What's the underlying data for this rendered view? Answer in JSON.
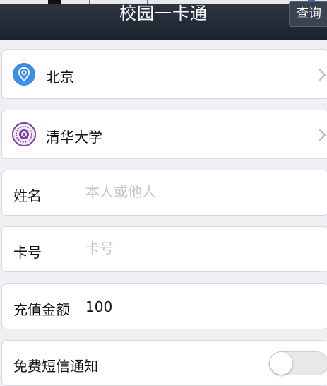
{
  "header": {
    "title": "校园一卡通",
    "query_label": "查询"
  },
  "location": {
    "city": "北京",
    "icon": "location-pin-icon",
    "icon_color": "#3d8ee6"
  },
  "school": {
    "name": "清华大学",
    "icon": "university-seal-icon",
    "icon_color": "#7b3fa0"
  },
  "form": {
    "name_label": "姓名",
    "name_placeholder": "本人或他人",
    "card_label": "卡号",
    "card_placeholder": "卡号",
    "amount_label": "充值金额",
    "amount_value": "100",
    "sms_label": "免费短信通知",
    "sms_enabled": false
  },
  "colors": {
    "header_bg": "#1d2430",
    "page_bg": "#efeff4"
  }
}
